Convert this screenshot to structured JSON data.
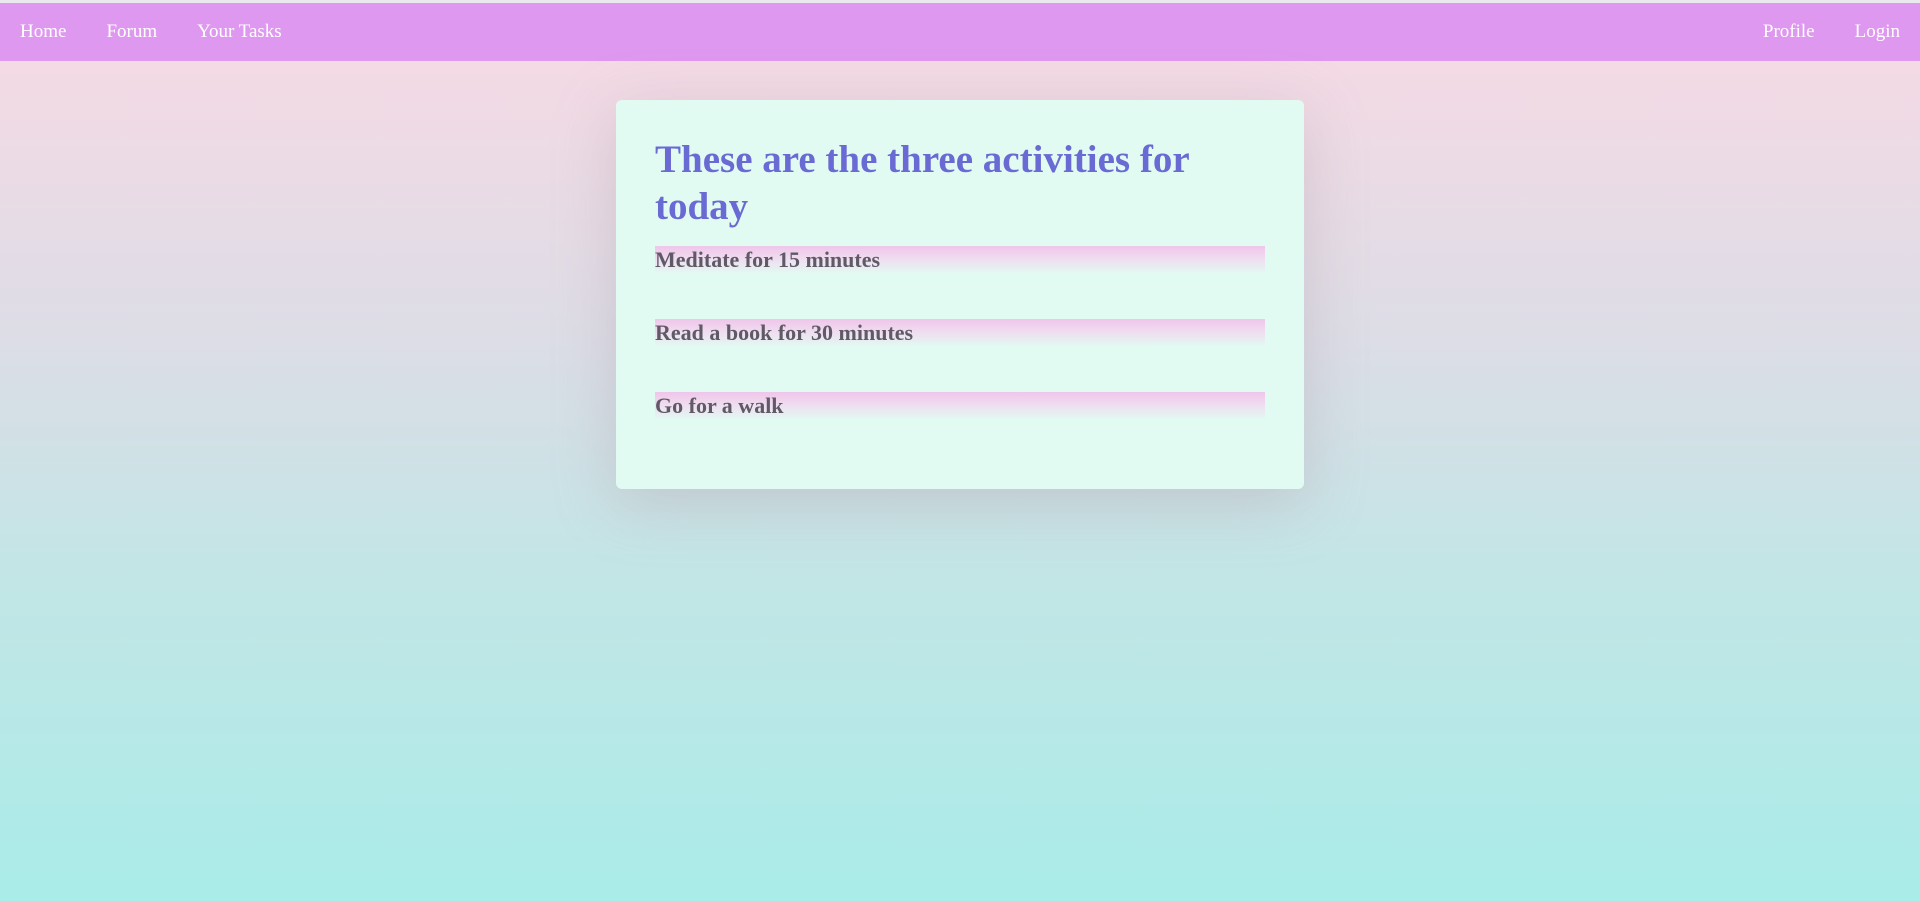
{
  "nav": {
    "left": [
      {
        "label": "Home"
      },
      {
        "label": "Forum"
      },
      {
        "label": "Your Tasks"
      }
    ],
    "right": [
      {
        "label": "Profile"
      },
      {
        "label": "Login"
      }
    ]
  },
  "card": {
    "title": "These are the three activities for today",
    "activities": [
      {
        "label": "Meditate for 15 minutes"
      },
      {
        "label": "Read a book for 30 minutes"
      },
      {
        "label": "Go for a walk"
      }
    ]
  },
  "colors": {
    "navbar": "#df98ef",
    "title": "#6a6ad4",
    "card_background": "#e2fbf2",
    "activity_text": "#5f5a66"
  }
}
